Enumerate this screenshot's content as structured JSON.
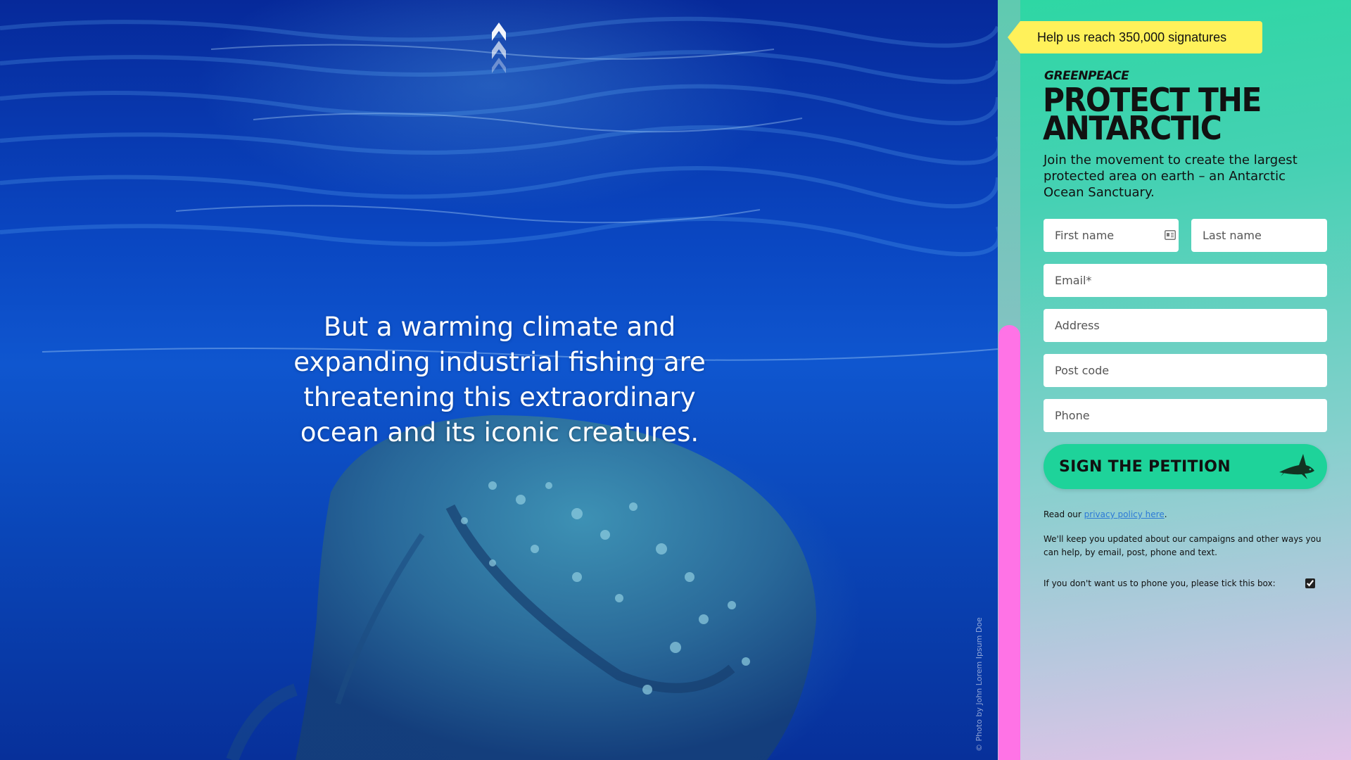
{
  "hero": {
    "statement": "But a warming climate and expanding industrial fishing are threatening this extraordinary ocean and its iconic creatures.",
    "photo_credit": "© Photo by John Lorem Ipsum Doe",
    "scroll_icon": "triple-chevron-up-icon"
  },
  "panel": {
    "badge": "Help us reach 350,000 signatures",
    "logo": "GREENPEACE",
    "title": "PROTECT THE ANTARCTIC",
    "lede": "Join the movement to create the largest protected area on earth – an Antarctic Ocean Sanctuary.",
    "form": {
      "first_name": "First name",
      "last_name": "Last name",
      "email": "Email*",
      "address": "Address",
      "postcode": "Post code",
      "phone": "Phone",
      "submit": "SIGN THE PETITION"
    },
    "privacy_prefix": "Read our ",
    "privacy_link": "privacy policy here",
    "privacy_suffix": ".",
    "updates": "We'll keep you updated about our campaigns and other ways you can help, by email, post, phone and text.",
    "phone_opt_out": "If you don't want us to phone you, please tick this box:",
    "phone_opt_out_checked": true
  },
  "colors": {
    "accent_green": "#1ed39a",
    "badge_yellow": "#fff15a",
    "rail_pink": "#ff73e6",
    "ocean_blue": "#0a47c2"
  }
}
